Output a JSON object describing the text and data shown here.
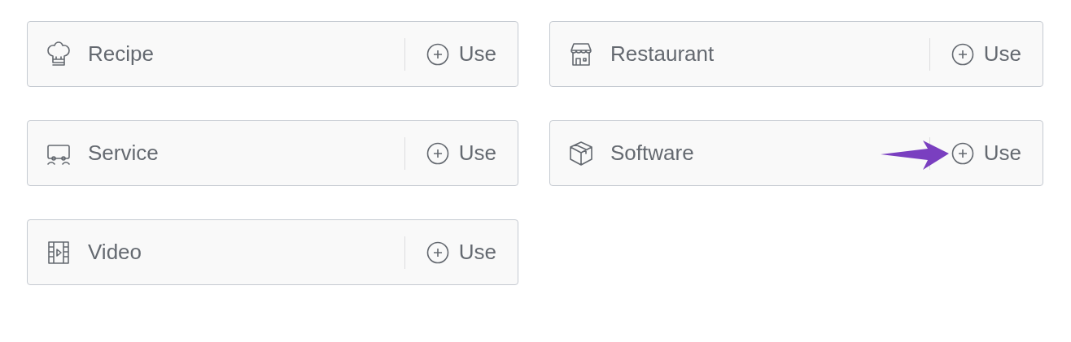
{
  "schema_types": [
    {
      "kind": "chef",
      "label": "Recipe",
      "action": "Use",
      "pointed": false
    },
    {
      "kind": "store",
      "label": "Restaurant",
      "action": "Use",
      "pointed": false
    },
    {
      "kind": "vehicle",
      "label": "Service",
      "action": "Use",
      "pointed": false
    },
    {
      "kind": "box",
      "label": "Software",
      "action": "Use",
      "pointed": true
    },
    {
      "kind": "film",
      "label": "Video",
      "action": "Use",
      "pointed": false
    }
  ]
}
